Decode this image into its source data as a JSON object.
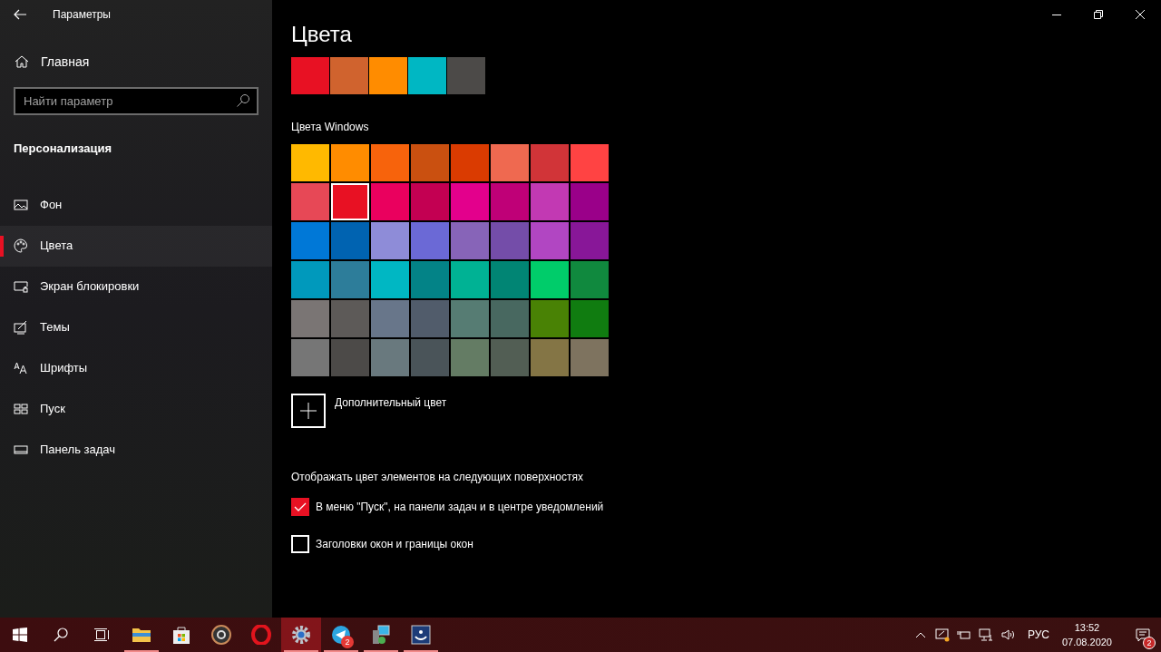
{
  "window": {
    "title": "Параметры"
  },
  "sidebar": {
    "home": "Главная",
    "search": {
      "placeholder": "Найти параметр"
    },
    "section": "Персонализация",
    "items": [
      {
        "label": "Фон",
        "kind": "picture",
        "selected": false
      },
      {
        "label": "Цвета",
        "kind": "palette",
        "selected": true
      },
      {
        "label": "Экран блокировки",
        "kind": "lock",
        "selected": false
      },
      {
        "label": "Темы",
        "kind": "themes",
        "selected": false
      },
      {
        "label": "Шрифты",
        "kind": "fonts",
        "selected": false
      },
      {
        "label": "Пуск",
        "kind": "start",
        "selected": false
      },
      {
        "label": "Панель задач",
        "kind": "taskbar",
        "selected": false
      }
    ]
  },
  "page": {
    "title": "Цвета",
    "recent_colors": [
      {
        "color": "#e81123"
      },
      {
        "color": "#d0632e"
      },
      {
        "color": "#ff8c00"
      },
      {
        "color": "#00b7c3"
      },
      {
        "color": "#4c4a48"
      }
    ],
    "windows_colors_label": "Цвета Windows",
    "windows_colors": [
      {
        "color": "#ffb900",
        "selected": false
      },
      {
        "color": "#ff8c00",
        "selected": false
      },
      {
        "color": "#f7630c",
        "selected": false
      },
      {
        "color": "#ca5010",
        "selected": false
      },
      {
        "color": "#da3b01",
        "selected": false
      },
      {
        "color": "#ef6950",
        "selected": false
      },
      {
        "color": "#d13438",
        "selected": false
      },
      {
        "color": "#ff4343",
        "selected": false
      },
      {
        "color": "#e74856",
        "selected": false
      },
      {
        "color": "#e81123",
        "selected": true
      },
      {
        "color": "#ea005e",
        "selected": false
      },
      {
        "color": "#c30052",
        "selected": false
      },
      {
        "color": "#e3008c",
        "selected": false
      },
      {
        "color": "#bf0077",
        "selected": false
      },
      {
        "color": "#c239b3",
        "selected": false
      },
      {
        "color": "#9a0089",
        "selected": false
      },
      {
        "color": "#0078d7",
        "selected": false
      },
      {
        "color": "#0063b1",
        "selected": false
      },
      {
        "color": "#8e8cd8",
        "selected": false
      },
      {
        "color": "#6b69d6",
        "selected": false
      },
      {
        "color": "#8764b8",
        "selected": false
      },
      {
        "color": "#744da9",
        "selected": false
      },
      {
        "color": "#b146c2",
        "selected": false
      },
      {
        "color": "#881798",
        "selected": false
      },
      {
        "color": "#0099bc",
        "selected": false
      },
      {
        "color": "#2d7d9a",
        "selected": false
      },
      {
        "color": "#00b7c3",
        "selected": false
      },
      {
        "color": "#038387",
        "selected": false
      },
      {
        "color": "#00b294",
        "selected": false
      },
      {
        "color": "#018574",
        "selected": false
      },
      {
        "color": "#00cc6a",
        "selected": false
      },
      {
        "color": "#10893e",
        "selected": false
      },
      {
        "color": "#7a7574",
        "selected": false
      },
      {
        "color": "#5d5a58",
        "selected": false
      },
      {
        "color": "#68768a",
        "selected": false
      },
      {
        "color": "#515c6b",
        "selected": false
      },
      {
        "color": "#567c73",
        "selected": false
      },
      {
        "color": "#486860",
        "selected": false
      },
      {
        "color": "#498205",
        "selected": false
      },
      {
        "color": "#107c10",
        "selected": false
      },
      {
        "color": "#767676",
        "selected": false
      },
      {
        "color": "#4c4a48",
        "selected": false
      },
      {
        "color": "#69797e",
        "selected": false
      },
      {
        "color": "#4a5459",
        "selected": false
      },
      {
        "color": "#647c64",
        "selected": false
      },
      {
        "color": "#525e54",
        "selected": false
      },
      {
        "color": "#847545",
        "selected": false
      },
      {
        "color": "#7e735f",
        "selected": false
      }
    ],
    "custom_color": "Дополнительный цвет",
    "surfaces_label": "Отображать цвет элементов на следующих поверхностях",
    "checkboxes": [
      {
        "label": "В меню \"Пуск\", на панели задач и в центре уведомлений",
        "checked": true
      },
      {
        "label": "Заголовки окон и границы окон",
        "checked": false
      }
    ]
  },
  "taskbar": {
    "apps": [
      {
        "kind": "explorer",
        "selected": false,
        "running": true
      },
      {
        "kind": "store",
        "selected": false,
        "running": false
      },
      {
        "kind": "disc",
        "selected": false,
        "running": false
      },
      {
        "kind": "opera",
        "selected": false,
        "running": false
      },
      {
        "kind": "settings",
        "selected": true,
        "running": true
      },
      {
        "kind": "telegram",
        "selected": false,
        "running": true,
        "badge": "2"
      },
      {
        "kind": "network-tool",
        "selected": false,
        "running": true
      },
      {
        "kind": "app",
        "selected": false,
        "running": true
      }
    ],
    "language": "РУС",
    "time": "13:52",
    "date": "07.08.2020",
    "notifications": "2"
  }
}
